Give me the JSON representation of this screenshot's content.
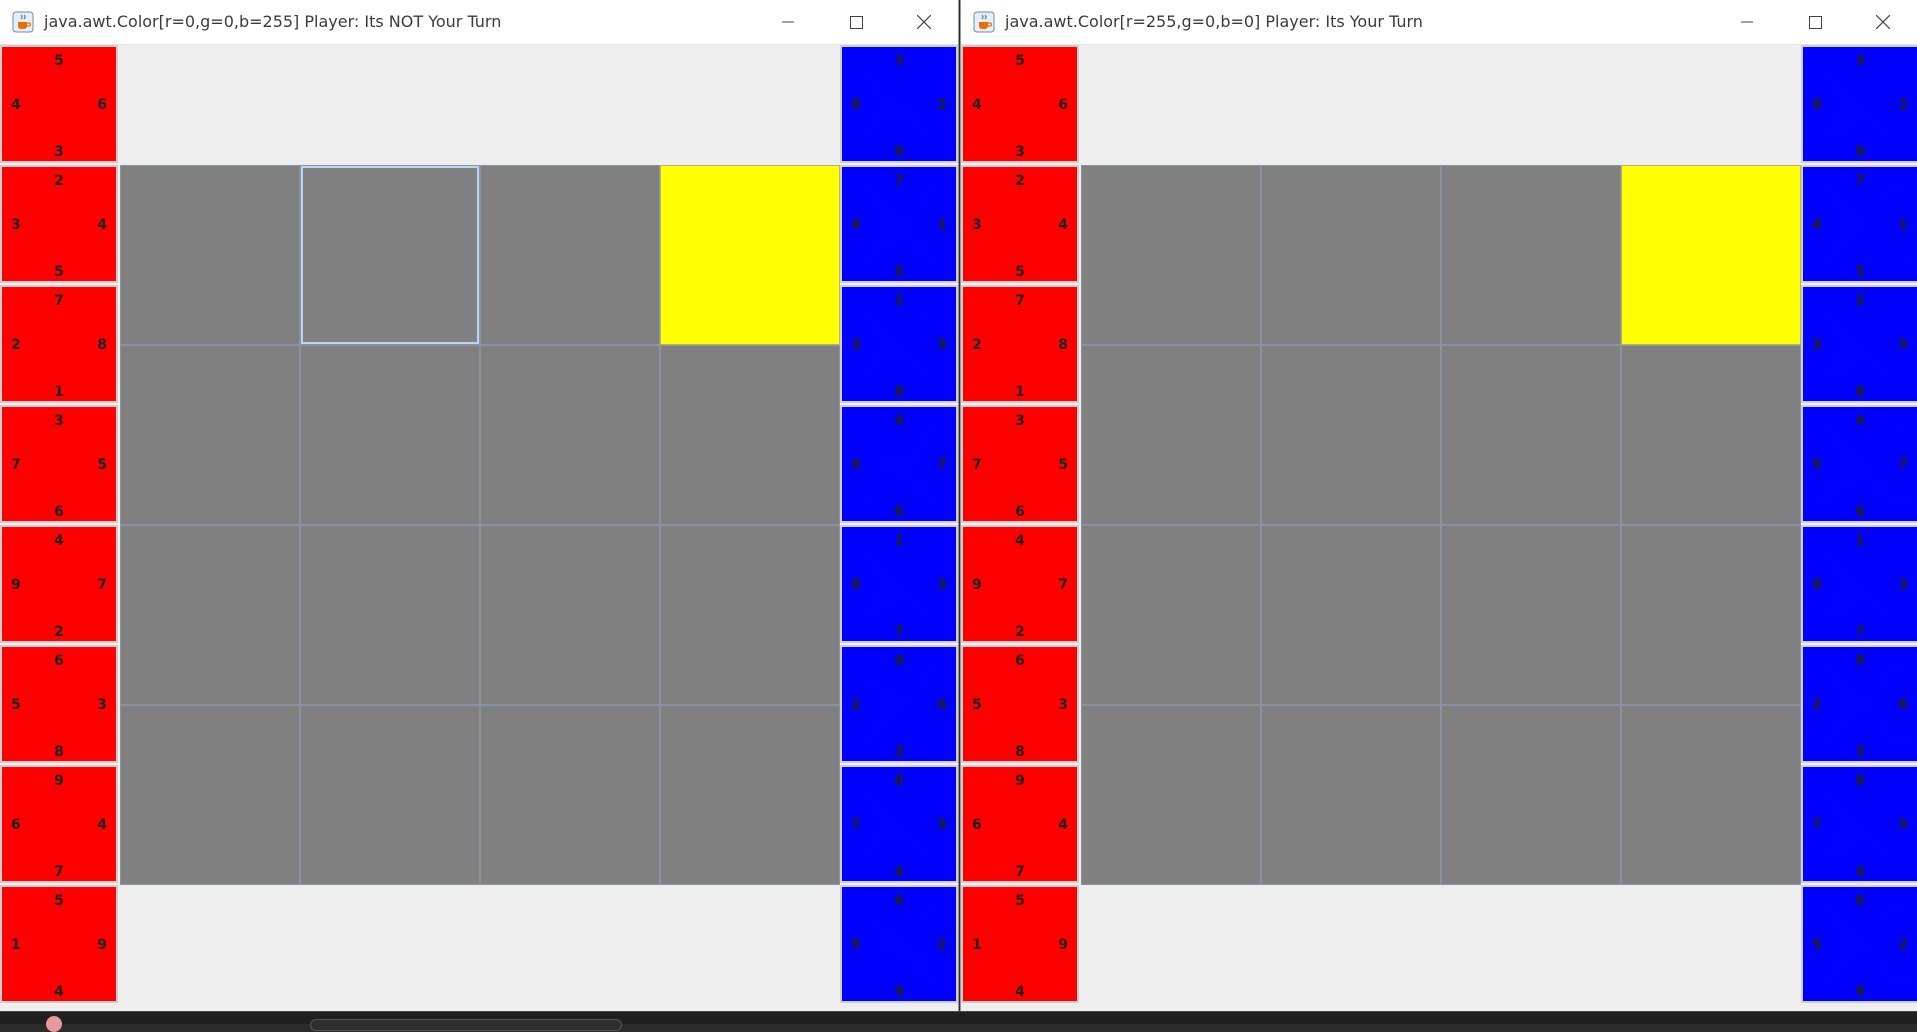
{
  "windows": [
    {
      "title": "java.awt.Color[r=0,g=0,b=255] Player: Its NOT Your Turn",
      "red_hand": [
        {
          "n": "5",
          "w": "4",
          "e": "6",
          "s": "3"
        },
        {
          "n": "2",
          "w": "3",
          "e": "4",
          "s": "5"
        },
        {
          "n": "7",
          "w": "2",
          "e": "8",
          "s": "1"
        },
        {
          "n": "3",
          "w": "7",
          "e": "5",
          "s": "6"
        },
        {
          "n": "4",
          "w": "9",
          "e": "7",
          "s": "2"
        },
        {
          "n": "6",
          "w": "5",
          "e": "3",
          "s": "8"
        },
        {
          "n": "9",
          "w": "6",
          "e": "4",
          "s": "7"
        },
        {
          "n": "5",
          "w": "1",
          "e": "9",
          "s": "4"
        }
      ],
      "blue_hand": [
        {
          "n": "3",
          "w": "8",
          "e": "2",
          "s": "9"
        },
        {
          "n": "7",
          "w": "4",
          "e": "1",
          "s": "5"
        },
        {
          "n": "2",
          "w": "3",
          "e": "5",
          "s": "8"
        },
        {
          "n": "4",
          "w": "9",
          "e": "7",
          "s": "6"
        },
        {
          "n": "1",
          "w": "8",
          "e": "3",
          "s": "7"
        },
        {
          "n": "9",
          "w": "2",
          "e": "6",
          "s": "3"
        },
        {
          "n": "8",
          "w": "7",
          "e": "5",
          "s": "4"
        },
        {
          "n": "6",
          "w": "5",
          "e": "2",
          "s": "9"
        }
      ],
      "board": {
        "rows": 4,
        "cols": 4,
        "yellow_cells": [
          [
            0,
            3
          ]
        ],
        "selected_cell": [
          0,
          1
        ]
      }
    },
    {
      "title": "java.awt.Color[r=255,g=0,b=0] Player: Its Your Turn",
      "red_hand": [
        {
          "n": "5",
          "w": "4",
          "e": "6",
          "s": "3"
        },
        {
          "n": "2",
          "w": "3",
          "e": "4",
          "s": "5"
        },
        {
          "n": "7",
          "w": "2",
          "e": "8",
          "s": "1"
        },
        {
          "n": "3",
          "w": "7",
          "e": "5",
          "s": "6"
        },
        {
          "n": "4",
          "w": "9",
          "e": "7",
          "s": "2"
        },
        {
          "n": "6",
          "w": "5",
          "e": "3",
          "s": "8"
        },
        {
          "n": "9",
          "w": "6",
          "e": "4",
          "s": "7"
        },
        {
          "n": "5",
          "w": "1",
          "e": "9",
          "s": "4"
        }
      ],
      "blue_hand": [
        {
          "n": "3",
          "w": "8",
          "e": "2",
          "s": "9"
        },
        {
          "n": "7",
          "w": "4",
          "e": "1",
          "s": "5"
        },
        {
          "n": "2",
          "w": "3",
          "e": "5",
          "s": "8"
        },
        {
          "n": "4",
          "w": "9",
          "e": "7",
          "s": "6"
        },
        {
          "n": "1",
          "w": "8",
          "e": "3",
          "s": "7"
        },
        {
          "n": "9",
          "w": "2",
          "e": "6",
          "s": "3"
        },
        {
          "n": "8",
          "w": "7",
          "e": "5",
          "s": "4"
        },
        {
          "n": "6",
          "w": "5",
          "e": "2",
          "s": "9"
        }
      ],
      "board": {
        "rows": 4,
        "cols": 4,
        "yellow_cells": [
          [
            0,
            3
          ]
        ],
        "selected_cell": null
      }
    }
  ],
  "colors": {
    "red_card": "#ff0000",
    "blue_card": "#0000ff",
    "board_cell": "#808080",
    "highlight_cell": "#ffff00"
  }
}
